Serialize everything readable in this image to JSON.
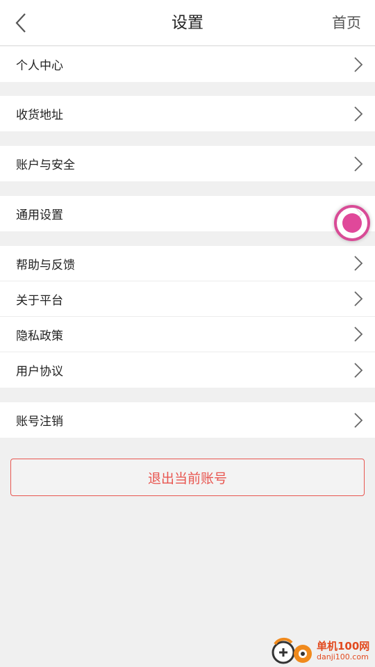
{
  "header": {
    "title": "设置",
    "home_label": "首页"
  },
  "groups": [
    {
      "items": [
        {
          "label": "个人中心"
        }
      ]
    },
    {
      "items": [
        {
          "label": "收货地址"
        }
      ]
    },
    {
      "items": [
        {
          "label": "账户与安全"
        }
      ]
    },
    {
      "items": [
        {
          "label": "通用设置"
        }
      ]
    },
    {
      "items": [
        {
          "label": "帮助与反馈"
        },
        {
          "label": "关于平台"
        },
        {
          "label": "隐私政策"
        },
        {
          "label": "用户协议"
        }
      ]
    },
    {
      "items": [
        {
          "label": "账号注销"
        }
      ]
    }
  ],
  "logout": {
    "label": "退出当前账号"
  },
  "watermark": {
    "name": "单机100网",
    "domain": "danji100.com"
  },
  "colors": {
    "accent": "#e8554f",
    "floating_ball": "#e0489a",
    "watermark": "#e24a1f"
  }
}
